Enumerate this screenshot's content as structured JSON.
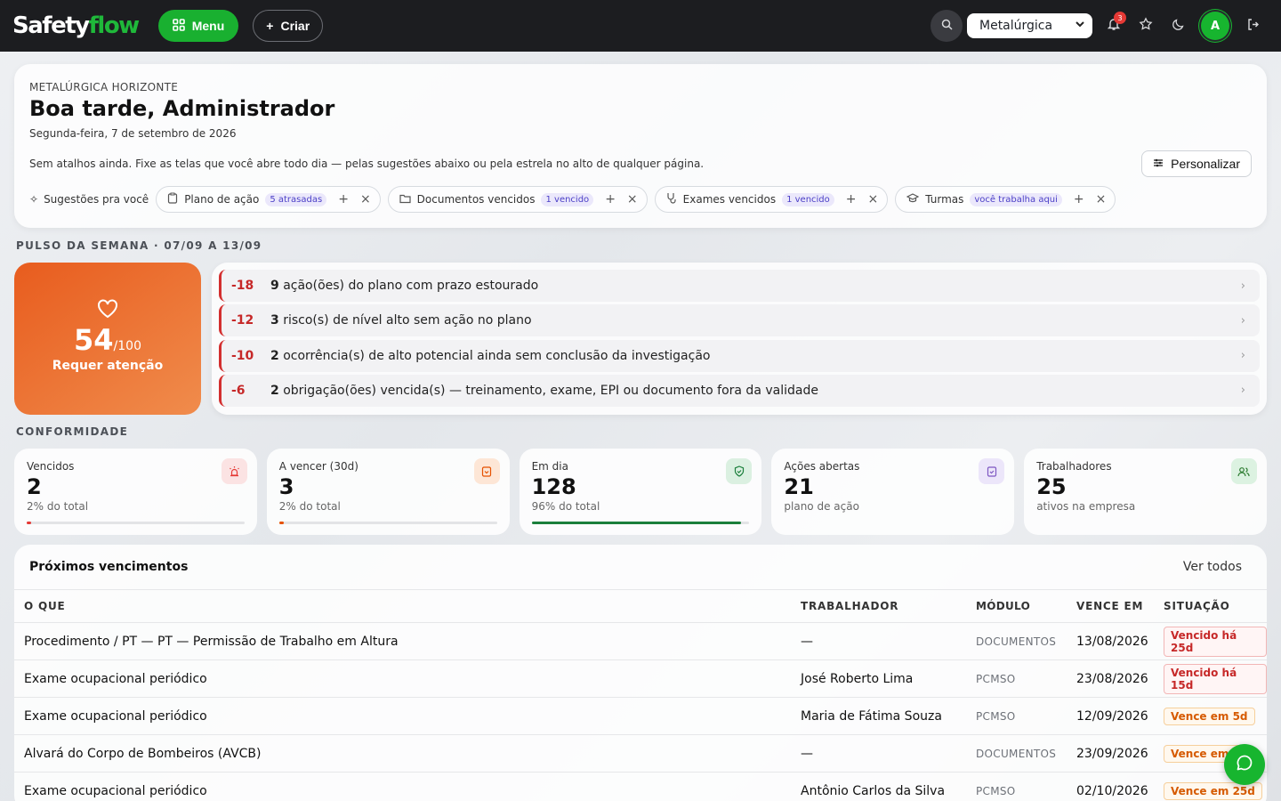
{
  "topbar": {
    "logo_part1": "Safety",
    "logo_part2": "flow",
    "menu_label": "Menu",
    "criar_label": "Criar",
    "org_select": "Metalúrgica",
    "notifications_count": "3",
    "avatar_initial": "A"
  },
  "welcome": {
    "company": "METALÚRGICA HORIZONTE",
    "greeting": "Boa tarde, Administrador",
    "date": "Segunda-feira, 7 de setembro de 2026",
    "no_shortcuts": "Sem atalhos ainda. Fixe as telas que você abre todo dia — pelas sugestões abaixo ou pela estrela no alto de qualquer página.",
    "personalize_label": "Personalizar",
    "suggestions_label": "Sugestões pra você",
    "chips": [
      {
        "label": "Plano de ação",
        "tag": "5 atrasadas",
        "icon": "clipboard-icon"
      },
      {
        "label": "Documentos vencidos",
        "tag": "1 vencido",
        "icon": "folder-icon"
      },
      {
        "label": "Exames vencidos",
        "tag": "1 vencido",
        "icon": "stethoscope-icon"
      },
      {
        "label": "Turmas",
        "tag": "você trabalha aqui",
        "icon": "graduation-cap-icon"
      }
    ]
  },
  "pulse": {
    "title": "PULSO DA SEMANA · 07/09 A 13/09",
    "score": "54",
    "score_max": "/100",
    "score_label": "Requer atenção",
    "items": [
      {
        "points": "-18",
        "count": "9",
        "text": " ação(ões) do plano com prazo estourado"
      },
      {
        "points": "-12",
        "count": "3",
        "text": " risco(s) de nível alto sem ação no plano"
      },
      {
        "points": "-10",
        "count": "2",
        "text": " ocorrência(s) de alto potencial ainda sem conclusão da investigação"
      },
      {
        "points": "-6",
        "count": "2",
        "text": " obrigação(ões) vencida(s) — treinamento, exame, EPI ou documento fora da validade"
      }
    ]
  },
  "conformidade": {
    "title": "CONFORMIDADE",
    "kpis": [
      {
        "label": "Vencidos",
        "value": "2",
        "sub": "2% do total",
        "progress": 0.02,
        "color": "#e53935",
        "icon": "alarm-icon",
        "icon_bg": "#fbe3e3"
      },
      {
        "label": "A vencer (30d)",
        "value": "3",
        "sub": "2% do total",
        "progress": 0.02,
        "color": "#e65100",
        "icon": "clipboard-icon",
        "icon_bg": "#fde6d6"
      },
      {
        "label": "Em dia",
        "value": "128",
        "sub": "96% do total",
        "progress": 0.96,
        "color": "#1b7f3b",
        "icon": "shield-icon",
        "icon_bg": "#dbf0e1"
      },
      {
        "label": "Ações abertas",
        "value": "21",
        "sub": "plano de ação",
        "progress": null,
        "color": "#7e57c2",
        "icon": "clipboard-check-icon",
        "icon_bg": "#ece6fa"
      },
      {
        "label": "Trabalhadores",
        "value": "25",
        "sub": "ativos na empresa",
        "progress": null,
        "color": "#2e7d32",
        "icon": "users-icon",
        "icon_bg": "#dcf2e1"
      }
    ]
  },
  "vencimentos": {
    "title": "Próximos vencimentos",
    "see_all": "Ver todos",
    "columns": [
      "O QUE",
      "TRABALHADOR",
      "MÓDULO",
      "VENCE EM",
      "SITUAÇÃO"
    ],
    "rows": [
      {
        "what": "Procedimento / PT — PT — Permissão de Trabalho em Altura",
        "worker": "—",
        "module": "DOCUMENTOS",
        "due": "13/08/2026",
        "status": "Vencido há 25d",
        "kind": "over"
      },
      {
        "what": "Exame ocupacional periódico",
        "worker": "José Roberto Lima",
        "module": "PCMSO",
        "due": "23/08/2026",
        "status": "Vencido há 15d",
        "kind": "over"
      },
      {
        "what": "Exame ocupacional periódico",
        "worker": "Maria de Fátima Souza",
        "module": "PCMSO",
        "due": "12/09/2026",
        "status": "Vence em 5d",
        "kind": "soon"
      },
      {
        "what": "Alvará do Corpo de Bombeiros (AVCB)",
        "worker": "—",
        "module": "DOCUMENTOS",
        "due": "23/09/2026",
        "status": "Vence em 1",
        "kind": "soon"
      },
      {
        "what": "Exame ocupacional periódico",
        "worker": "Antônio Carlos da Silva",
        "module": "PCMSO",
        "due": "02/10/2026",
        "status": "Vence em 25d",
        "kind": "soon"
      }
    ]
  }
}
